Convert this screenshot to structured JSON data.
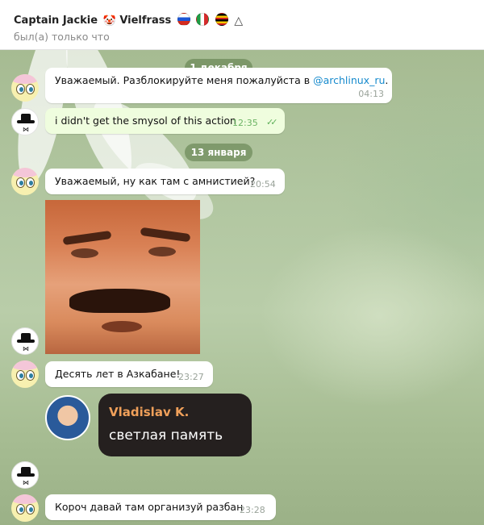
{
  "header": {
    "title": "Captain Jackie",
    "subtitle_name": "Vielfrass",
    "status": "был(а) только что",
    "badge_icons": [
      "clown-face-icon",
      "russia-flag-icon",
      "italy-flag-icon",
      "uganda-flag-icon",
      "triangle-icon"
    ]
  },
  "messages": [
    {
      "id": "d1",
      "type": "date",
      "text": "1 декабря"
    },
    {
      "id": "m1",
      "direction": "in",
      "text": "Уважаемый. Разблокируйте меня пожалуйста в ",
      "link": "@archlinux_ru",
      "suffix": ".",
      "time": "04:13"
    },
    {
      "id": "m2",
      "direction": "out",
      "text": "i didn't get the smysol of this action",
      "time": "12:35",
      "read": true
    },
    {
      "id": "d2",
      "type": "date",
      "text": "13 января"
    },
    {
      "id": "m3",
      "direction": "in",
      "text": "Уважаемый, ну как там с амнистией?",
      "time": "20:54"
    },
    {
      "id": "m4",
      "direction": "out",
      "type": "sticker",
      "sticker": "laughing-man-face-sticker"
    },
    {
      "id": "m5",
      "direction": "in",
      "text": "Десять лет в Азкабане!",
      "time": "23:27"
    },
    {
      "id": "m6",
      "direction": "in",
      "type": "forward",
      "author": "Vladislav K.",
      "text": "светлая память"
    },
    {
      "id": "m7",
      "direction": "in",
      "text": "Короч давай там организуй разбан",
      "time": "23:28"
    }
  ],
  "colors": {
    "link": "#168acd",
    "outgoing_bubble": "#effdde",
    "incoming_bubble": "#ffffff",
    "forward_author": "#f0a05a",
    "date_pill": "#6d8c55"
  }
}
